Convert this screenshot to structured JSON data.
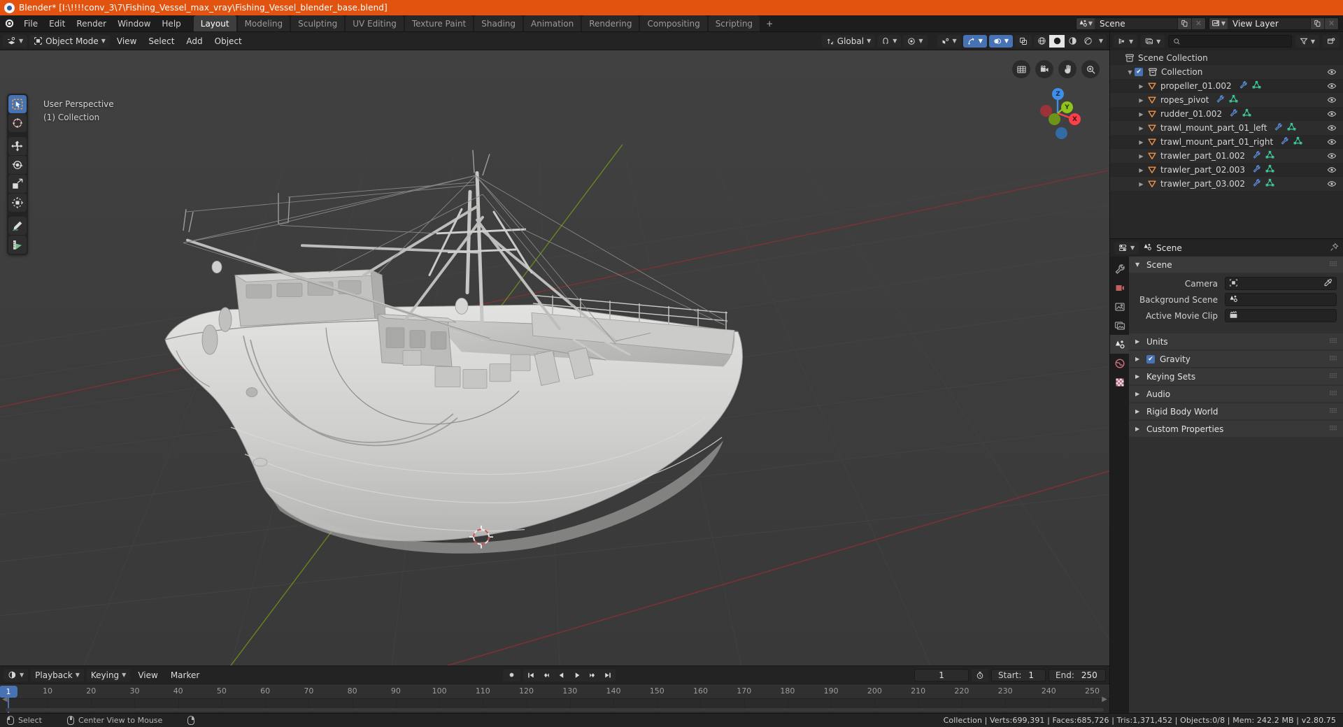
{
  "window": {
    "title": "Blender* [I:\\!!!!conv_3\\7\\Fishing_Vessel_max_vray\\Fishing_Vessel_blender_base.blend]",
    "app_icon": "blender-icon"
  },
  "topbar": {
    "menus": [
      "File",
      "Edit",
      "Render",
      "Window",
      "Help"
    ],
    "workspaces": [
      {
        "label": "Layout",
        "active": true
      },
      {
        "label": "Modeling",
        "active": false
      },
      {
        "label": "Sculpting",
        "active": false
      },
      {
        "label": "UV Editing",
        "active": false
      },
      {
        "label": "Texture Paint",
        "active": false
      },
      {
        "label": "Shading",
        "active": false
      },
      {
        "label": "Animation",
        "active": false
      },
      {
        "label": "Rendering",
        "active": false
      },
      {
        "label": "Compositing",
        "active": false
      },
      {
        "label": "Scripting",
        "active": false
      }
    ],
    "add_workspace_label": "+",
    "scene_selector": {
      "icon": "scene-icon",
      "value": "Scene",
      "new_btn": "new-icon",
      "unlink_btn": "x"
    },
    "viewlayer_selector": {
      "icon": "viewlayer-icon",
      "value": "View Layer",
      "new_btn": "new-icon",
      "unlink_btn": "x"
    }
  },
  "viewport_header": {
    "editor_type_icon": "editor-type-3dview",
    "mode": "Object Mode",
    "menus": [
      "View",
      "Select",
      "Add",
      "Object"
    ],
    "transform_orientation": {
      "icon": "orientation-icon",
      "value": "Global"
    },
    "snap_icon": "magnet-icon",
    "proportional_icon": "proportional-edit-icon",
    "falloff_icon": "falloff-icon",
    "visibility_icon": "visibility-icon",
    "gizmo_icon": "gizmo-icon",
    "overlays_icon": "overlays-icon",
    "xray_icon": "xray-icon",
    "shading_modes": [
      "wireframe",
      "solid",
      "material",
      "rendered"
    ],
    "shading_active_index": 1
  },
  "viewport": {
    "overlay_line1": "User Perspective",
    "overlay_line2": "(1) Collection",
    "toolbar_tools": [
      {
        "name": "tweak-select-tool",
        "active": true
      },
      {
        "name": "cursor-tool",
        "active": false
      },
      {
        "name": "move-tool",
        "active": false
      },
      {
        "name": "rotate-tool",
        "active": false
      },
      {
        "name": "scale-tool",
        "active": false
      },
      {
        "name": "transform-tool",
        "active": false
      },
      {
        "name": "annotate-tool",
        "active": false
      },
      {
        "name": "measure-tool",
        "active": false
      }
    ],
    "nav_buttons": [
      "toggle-orthographic-icon",
      "camera-view-icon",
      "pan-view-icon",
      "zoom-view-icon"
    ],
    "axis_labels": {
      "x": "X",
      "y": "Y",
      "z": "Z"
    },
    "axis_colors": {
      "x": "#fc4049",
      "y": "#8ec41b",
      "z": "#3e8eec",
      "x_neg": "#9b3237",
      "y_neg": "#6d9419",
      "z_neg": "#336ba5"
    },
    "model_description": "fishing trawler vessel 3d model, grey untextured solid shading"
  },
  "outliner": {
    "display_mode_icon": "outliner-display-mode-icon",
    "filter_id_icon": "filter-id-icon",
    "search_placeholder": "",
    "search_icon": "search-icon",
    "filter_icon": "filter-icon",
    "new_collection_icon": "new-collection-icon",
    "rows": [
      {
        "label": "Scene Collection",
        "icon": "scene-collection-icon",
        "depth": 0,
        "disclosure": "",
        "checkbox": false,
        "trail": [],
        "eye": false
      },
      {
        "label": "Collection",
        "icon": "collection-icon",
        "depth": 1,
        "disclosure": "open",
        "checkbox": true,
        "trail": [],
        "eye": true
      },
      {
        "label": "propeller_01.002",
        "icon": "mesh-object-icon",
        "depth": 2,
        "disclosure": "closed",
        "checkbox": false,
        "trail": [
          "modifier-icon",
          "mesh-data-icon"
        ],
        "eye": true
      },
      {
        "label": "ropes_pivot",
        "icon": "mesh-object-icon",
        "depth": 2,
        "disclosure": "closed",
        "checkbox": false,
        "trail": [
          "modifier-icon",
          "mesh-data-icon"
        ],
        "eye": true
      },
      {
        "label": "rudder_01.002",
        "icon": "mesh-object-icon",
        "depth": 2,
        "disclosure": "closed",
        "checkbox": false,
        "trail": [
          "modifier-icon",
          "mesh-data-icon"
        ],
        "eye": true
      },
      {
        "label": "trawl_mount_part_01_left",
        "icon": "mesh-object-icon",
        "depth": 2,
        "disclosure": "closed",
        "checkbox": false,
        "trail": [
          "modifier-icon",
          "mesh-data-icon"
        ],
        "eye": true
      },
      {
        "label": "trawl_mount_part_01_right",
        "icon": "mesh-object-icon",
        "depth": 2,
        "disclosure": "closed",
        "checkbox": false,
        "trail": [
          "modifier-icon",
          "mesh-data-icon"
        ],
        "eye": true
      },
      {
        "label": "trawler_part_01.002",
        "icon": "mesh-object-icon",
        "depth": 2,
        "disclosure": "closed",
        "checkbox": false,
        "trail": [
          "modifier-icon",
          "mesh-data-icon"
        ],
        "eye": true
      },
      {
        "label": "trawler_part_02.003",
        "icon": "mesh-object-icon",
        "depth": 2,
        "disclosure": "closed",
        "checkbox": false,
        "trail": [
          "modifier-icon",
          "mesh-data-icon"
        ],
        "eye": true
      },
      {
        "label": "trawler_part_03.002",
        "icon": "mesh-object-icon",
        "depth": 2,
        "disclosure": "closed",
        "checkbox": false,
        "trail": [
          "modifier-icon",
          "mesh-data-icon"
        ],
        "eye": true
      }
    ]
  },
  "properties": {
    "editor_icon": "properties-editor-icon",
    "breadcrumb_icon": "scene-icon",
    "breadcrumb": "Scene",
    "pin_icon": "pin-icon",
    "tabs": [
      {
        "name": "tool-tab",
        "icon": "tool-icon",
        "active": false
      },
      {
        "name": "render-tab",
        "icon": "render-icon",
        "active": false
      },
      {
        "name": "output-tab",
        "icon": "output-icon",
        "active": false
      },
      {
        "name": "viewlayer-tab",
        "icon": "viewlayer-icon",
        "active": false
      },
      {
        "name": "scene-tab",
        "icon": "scene-icon",
        "active": true
      },
      {
        "name": "world-tab",
        "icon": "world-icon",
        "active": false
      },
      {
        "name": "texture-tab",
        "icon": "texture-icon",
        "active": false
      }
    ],
    "panels": [
      {
        "label": "Scene",
        "open": true,
        "fields": [
          {
            "label": "Camera",
            "icon": "camera-object-icon",
            "value": "",
            "eyedropper": true
          },
          {
            "label": "Background Scene",
            "icon": "scene-icon",
            "value": "",
            "eyedropper": false
          },
          {
            "label": "Active Movie Clip",
            "icon": "movieclip-icon",
            "value": "",
            "eyedropper": false
          }
        ]
      },
      {
        "label": "Units",
        "open": false,
        "checkbox": null
      },
      {
        "label": "Gravity",
        "open": false,
        "checkbox": true
      },
      {
        "label": "Keying Sets",
        "open": false,
        "checkbox": null
      },
      {
        "label": "Audio",
        "open": false,
        "checkbox": null
      },
      {
        "label": "Rigid Body World",
        "open": false,
        "checkbox": null
      },
      {
        "label": "Custom Properties",
        "open": false,
        "checkbox": null
      }
    ]
  },
  "timeline": {
    "editor_icon": "timeline-editor-icon",
    "menus": [
      "Playback",
      "Keying",
      "View",
      "Marker"
    ],
    "transport": [
      "record-icon",
      "jump-start-icon",
      "prev-keyframe-icon",
      "play-reverse-icon",
      "play-icon",
      "next-keyframe-icon",
      "jump-end-icon"
    ],
    "current_frame": "1",
    "auto_key_icon": "auto-keying-icon",
    "start_label": "Start:",
    "start_value": "1",
    "end_label": "End:",
    "end_value": "250",
    "ruler_ticks": [
      "10",
      "20",
      "30",
      "40",
      "50",
      "60",
      "70",
      "80",
      "90",
      "100",
      "110",
      "120",
      "130",
      "140",
      "150",
      "160",
      "170",
      "180",
      "190",
      "200",
      "210",
      "220",
      "230",
      "240",
      "250"
    ],
    "playhead_frame": "1"
  },
  "statusbar": {
    "hints": [
      {
        "icon": "mouse-left-icon",
        "label": "Select"
      },
      {
        "icon": "mouse-middle-icon",
        "label": "Center View to Mouse"
      },
      {
        "icon": "mouse-right-icon",
        "label": ""
      }
    ],
    "stats": "Collection | Verts:699,391 | Faces:685,726 | Tris:1,371,452 | Objects:0/8 | Mem: 242.2 MB | v2.80.75"
  },
  "colors": {
    "accent_blue": "#4772b3",
    "title_orange": "#e2530f",
    "mesh_orange": "#ed9247",
    "mesh_data_green": "#3ec998",
    "modifier_blue": "#5b8cd8"
  }
}
